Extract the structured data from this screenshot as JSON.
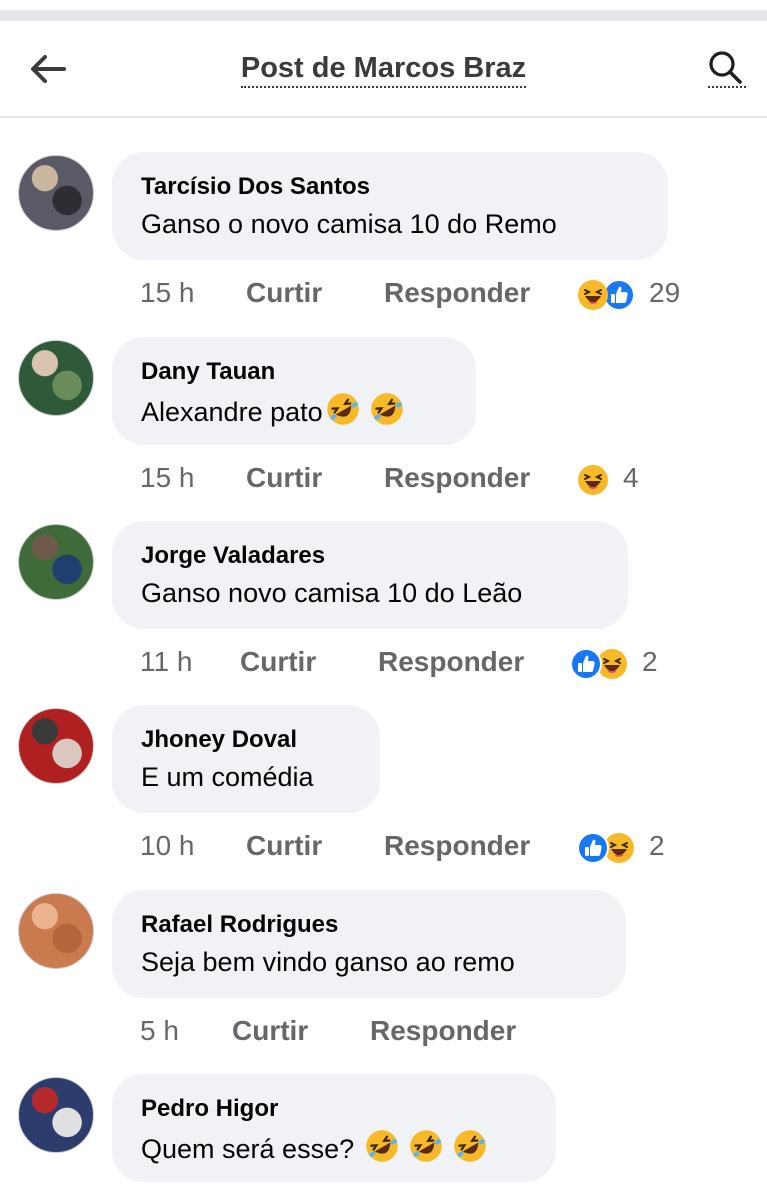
{
  "header": {
    "title": "Post de Marcos Braz",
    "back_icon": "arrow-left-icon",
    "search_icon": "search-icon"
  },
  "colors": {
    "bubble": "#f0f2f5",
    "meta_text": "#65676b",
    "like_blue": "#1877f2",
    "haha_yellow": "#f7b928"
  },
  "comments": [
    {
      "author": "Tarcísio Dos Santos",
      "text": "Ganso o novo camisa 10 do Remo",
      "text_emojis": 0,
      "time": "15 h",
      "like": "Curtir",
      "reply": "Responder",
      "reactions": [
        "haha",
        "like"
      ],
      "count": "29"
    },
    {
      "author": "Dany Tauan",
      "text": "Alexandre pato",
      "text_emojis": 2,
      "time": "15 h",
      "like": "Curtir",
      "reply": "Responder",
      "reactions": [
        "haha"
      ],
      "count": "4"
    },
    {
      "author": "Jorge Valadares",
      "text": "Ganso novo camisa 10 do Leão",
      "text_emojis": 0,
      "time": "11 h",
      "like": "Curtir",
      "reply": "Responder",
      "reactions": [
        "like",
        "haha"
      ],
      "count": "2"
    },
    {
      "author": "Jhoney Doval",
      "text": "E um comédia",
      "text_emojis": 0,
      "time": "10 h",
      "like": "Curtir",
      "reply": "Responder",
      "reactions": [
        "like",
        "haha"
      ],
      "count": "2"
    },
    {
      "author": "Rafael Rodrigues",
      "text": "Seja bem vindo ganso ao remo",
      "text_emojis": 0,
      "time": "5 h",
      "like": "Curtir",
      "reply": "Responder",
      "reactions": [],
      "count": ""
    },
    {
      "author": "Pedro Higor",
      "text": "Quem será esse? ",
      "text_emojis": 3,
      "time": "",
      "like": "",
      "reply": "",
      "reactions": [],
      "count": ""
    }
  ]
}
